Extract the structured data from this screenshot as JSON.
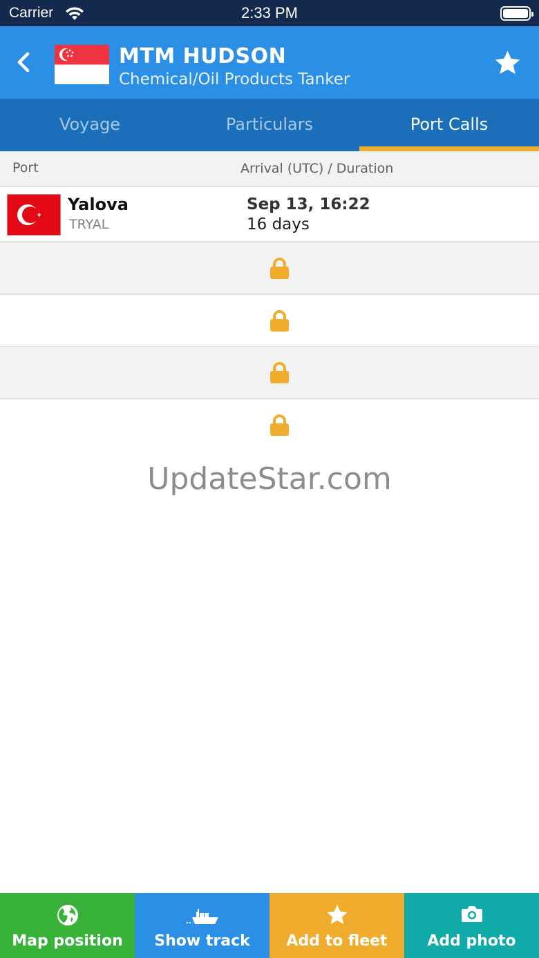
{
  "status_bar": {
    "carrier": "Carrier",
    "time": "2:33 PM"
  },
  "header": {
    "title": "MTM HUDSON",
    "subtitle": "Chemical/Oil Products Tanker",
    "flag": "singapore-flag-icon"
  },
  "tabs": [
    {
      "label": "Voyage",
      "active": false
    },
    {
      "label": "Particulars",
      "active": false
    },
    {
      "label": "Port Calls",
      "active": true
    }
  ],
  "columns": {
    "port": "Port",
    "arrival": "Arrival (UTC) / Duration"
  },
  "port_calls": [
    {
      "name": "Yalova",
      "code": "TRYAL",
      "arrival": "Sep 13, 16:22",
      "duration": "16 days",
      "flag": "turkey-flag-icon"
    }
  ],
  "locked_rows": 4,
  "watermark": "UpdateStar.com",
  "bottom_bar": {
    "map_position": "Map position",
    "show_track": "Show track",
    "add_to_fleet": "Add to fleet",
    "add_photo": "Add photo"
  },
  "colors": {
    "header": "#2b8fe6",
    "tabs": "#1b6fb9",
    "tab_indicator": "#f0ad2d",
    "lock": "#f0ad2d",
    "map_position": "#39b23a",
    "show_track": "#2b8fe6",
    "add_to_fleet": "#f0ad2d",
    "add_photo": "#10aaa8"
  }
}
